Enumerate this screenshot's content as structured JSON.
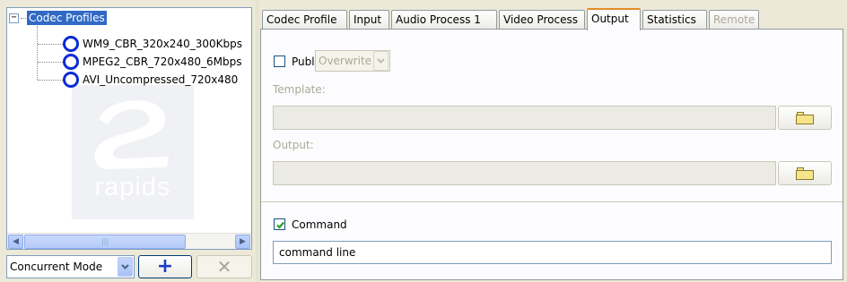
{
  "tree": {
    "root_label": "Codec Profiles",
    "items": [
      {
        "label": "WM9_CBR_320x240_300Kbps"
      },
      {
        "label": "MPEG2_CBR_720x480_6Mbps"
      },
      {
        "label": "AVI_Uncompressed_720x480"
      }
    ],
    "watermark_text": "rapids"
  },
  "bottom_bar": {
    "mode_value": "Concurrent Mode",
    "add_label": "+",
    "remove_label": "✕"
  },
  "tabs": [
    {
      "label": "Codec Profile",
      "state": "normal"
    },
    {
      "label": "Input",
      "state": "normal"
    },
    {
      "label": "Audio Process 1",
      "state": "normal"
    },
    {
      "label": "Video Process",
      "state": "normal"
    },
    {
      "label": "Output",
      "state": "active"
    },
    {
      "label": "Statistics",
      "state": "normal"
    },
    {
      "label": "Remote",
      "state": "disabled"
    }
  ],
  "output": {
    "publish_label": "Publish",
    "publish_checked": false,
    "overwrite_value": "Overwrite",
    "template_label": "Template:",
    "template_value": "",
    "output_label": "Output:",
    "output_value": "",
    "command_label": "Command",
    "command_checked": true,
    "command_value": "command line"
  },
  "colors": {
    "selection": "#316ac5",
    "active_tab_accent": "#e68b2c",
    "node_circle": "#0a2bd6",
    "checkmark": "#21a121"
  }
}
